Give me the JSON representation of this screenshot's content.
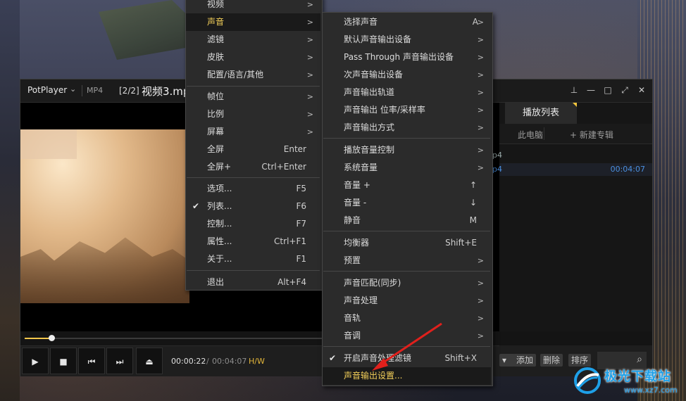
{
  "player": {
    "app_name": "PotPlayer",
    "format": "MP4",
    "file_index": "[2/2]",
    "file_title": "视频3.mp4",
    "time_current": "00:00:22",
    "time_separator": "/",
    "time_total": "00:04:07",
    "hw_badge": "H/W",
    "seek_fraction": 0.09
  },
  "playlist": {
    "tab_label": "播放列表",
    "sub_items": [
      "此电脑",
      "+ 新建专辑"
    ],
    "rows": [
      {
        "name": "p4",
        "duration": ""
      },
      {
        "name": "p4",
        "duration": "00:04:07"
      }
    ],
    "actions": [
      "添加",
      "删除",
      "排序"
    ]
  },
  "main_menu": {
    "items": [
      {
        "label": "视频",
        "shortcut": "",
        "arrow": ">"
      },
      {
        "label": "声音",
        "shortcut": "",
        "arrow": ">",
        "highlighted": true
      },
      {
        "label": "滤镜",
        "shortcut": "",
        "arrow": ">"
      },
      {
        "label": "皮肤",
        "shortcut": "",
        "arrow": ">"
      },
      {
        "label": "配置/语言/其他",
        "shortcut": "",
        "arrow": ">"
      },
      {
        "label": "帧位",
        "shortcut": "",
        "arrow": ">"
      },
      {
        "label": "比例",
        "shortcut": "",
        "arrow": ">"
      },
      {
        "label": "屏幕",
        "shortcut": "",
        "arrow": ">"
      },
      {
        "label": "全屏",
        "shortcut": "Enter",
        "arrow": ""
      },
      {
        "label": "全屏+",
        "shortcut": "Ctrl+Enter",
        "arrow": ""
      },
      {
        "label": "选项...",
        "shortcut": "F5",
        "arrow": ""
      },
      {
        "label": "列表...",
        "shortcut": "F6",
        "arrow": "",
        "checked": true
      },
      {
        "label": "控制...",
        "shortcut": "F7",
        "arrow": ""
      },
      {
        "label": "属性...",
        "shortcut": "Ctrl+F1",
        "arrow": ""
      },
      {
        "label": "关于...",
        "shortcut": "F1",
        "arrow": ""
      },
      {
        "label": "退出",
        "shortcut": "Alt+F4",
        "arrow": ""
      }
    ]
  },
  "sound_menu": {
    "items": [
      {
        "label": "选择声音",
        "shortcut": "A",
        "arrow": ">"
      },
      {
        "label": "默认声音输出设备",
        "shortcut": "",
        "arrow": ">"
      },
      {
        "label": "Pass Through 声音输出设备",
        "shortcut": "",
        "arrow": ">"
      },
      {
        "label": "次声音输出设备",
        "shortcut": "",
        "arrow": ">"
      },
      {
        "label": "声音输出轨道",
        "shortcut": "",
        "arrow": ">"
      },
      {
        "label": "声音输出 位率/采样率",
        "shortcut": "",
        "arrow": ">"
      },
      {
        "label": "声音输出方式",
        "shortcut": "",
        "arrow": ">"
      },
      {
        "label": "播放音量控制",
        "shortcut": "",
        "arrow": ">"
      },
      {
        "label": "系统音量",
        "shortcut": "",
        "arrow": ">"
      },
      {
        "label": "音量 +",
        "shortcut": "↑",
        "arrow": ""
      },
      {
        "label": "音量 -",
        "shortcut": "↓",
        "arrow": ""
      },
      {
        "label": "静音",
        "shortcut": "M",
        "arrow": ""
      },
      {
        "label": "均衡器",
        "shortcut": "Shift+E",
        "arrow": ""
      },
      {
        "label": "预置",
        "shortcut": "",
        "arrow": ">"
      },
      {
        "label": "声音匹配(同步)",
        "shortcut": "",
        "arrow": ">"
      },
      {
        "label": "声音处理",
        "shortcut": "",
        "arrow": ">"
      },
      {
        "label": "音轨",
        "shortcut": "",
        "arrow": ">"
      },
      {
        "label": "音调",
        "shortcut": "",
        "arrow": ">"
      },
      {
        "label": "开启声音处理滤镜",
        "shortcut": "Shift+X",
        "arrow": "",
        "checked": true
      },
      {
        "label": "声音输出设置...",
        "shortcut": "",
        "arrow": "",
        "highlighted": true
      }
    ]
  },
  "watermark": {
    "title": "极光下载站",
    "url": "www.xz7.com"
  },
  "colors": {
    "accent_yellow": "#f4d05a",
    "arrow_red": "#e0201c",
    "playlist_blue": "#4a8fe0"
  }
}
